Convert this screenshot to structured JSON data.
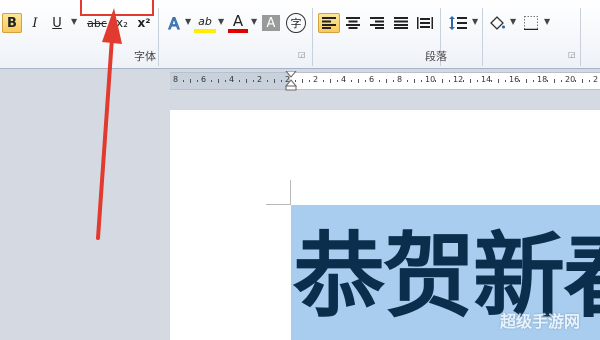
{
  "ribbon": {
    "font_group_label": "字体",
    "paragraph_group_label": "段落",
    "font_buttons": {
      "bold": "B",
      "italic": "I",
      "underline": "U",
      "strikethrough": "abc",
      "subscript": "x₂",
      "superscript": "x²",
      "text_effects": "A",
      "highlight": "ab",
      "font_color": "A",
      "char_shading": "A",
      "enclose": "字"
    },
    "font_size_box_value": ""
  },
  "ruler": {
    "numbers": [
      "8",
      "6",
      "4",
      "2",
      "2",
      "2",
      "4",
      "6",
      "8",
      "10",
      "12",
      "14",
      "16",
      "18",
      "20",
      "2"
    ]
  },
  "document": {
    "selected_text": "恭贺新春",
    "watermark": "超级手游网"
  },
  "colors": {
    "selection": "#a9cdef",
    "text": "#0b2e4d",
    "annotation": "#e23a2e",
    "active_button": "#f7c95c"
  }
}
